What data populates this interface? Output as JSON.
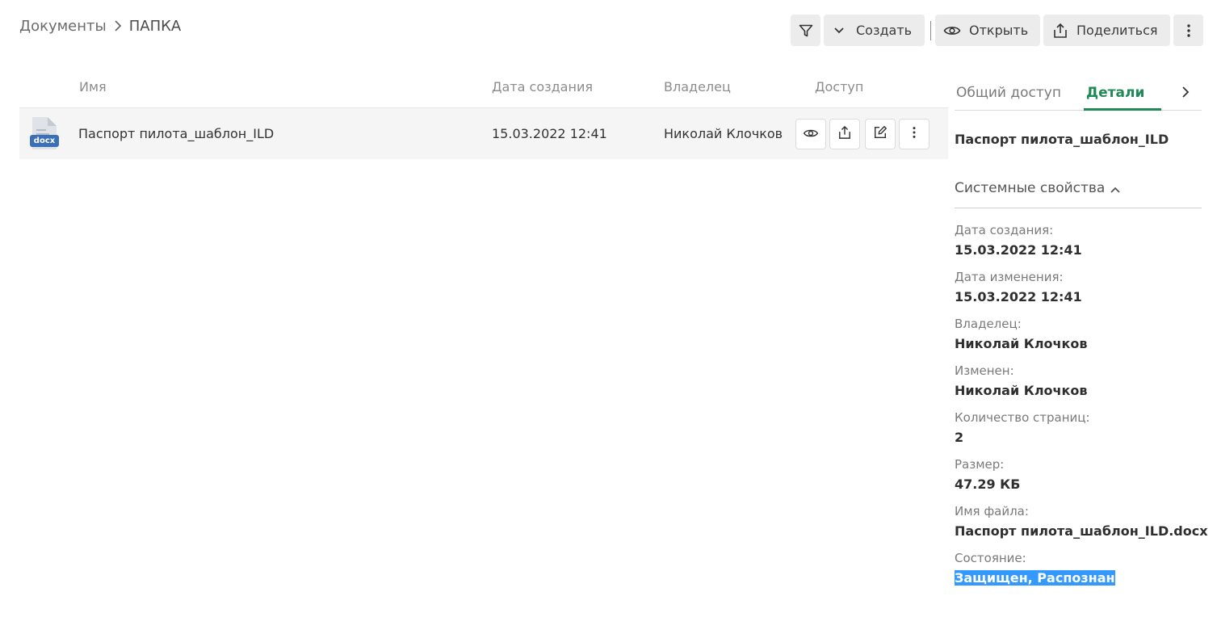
{
  "breadcrumb": {
    "root": "Документы",
    "current": "ПАПКА"
  },
  "toolbar": {
    "filter_icon": "filter-icon",
    "create_label": "Создать",
    "open_label": "Открыть",
    "share_label": "Поделиться"
  },
  "table": {
    "columns": {
      "name": "Имя",
      "created": "Дата создания",
      "owner": "Владелец",
      "access": "Доступ"
    },
    "rows": [
      {
        "icon_label": "docx",
        "name": "Паспорт пилота_шаблон_ILD",
        "created": "15.03.2022 12:41",
        "owner": "Николай Клочков"
      }
    ]
  },
  "panel": {
    "tabs": {
      "sharing": "Общий доступ",
      "details": "Детали"
    },
    "doc_title": "Паспорт пилота_шаблон_ILD",
    "section_title": "Системные свойства",
    "props": [
      {
        "label": "Дата создания:",
        "value": "15.03.2022 12:41"
      },
      {
        "label": "Дата изменения:",
        "value": "15.03.2022 12:41"
      },
      {
        "label": "Владелец:",
        "value": "Николай Клочков"
      },
      {
        "label": "Изменен:",
        "value": "Николай Клочков"
      },
      {
        "label": "Количество страниц:",
        "value": "2"
      },
      {
        "label": "Размер:",
        "value": "47.29 КБ"
      },
      {
        "label": "Имя файла:",
        "value": "Паспорт пилота_шаблон_ILD.docx"
      },
      {
        "label": "Состояние:",
        "value": "Защищен, Распознан"
      }
    ]
  },
  "colors": {
    "accent": "#1f8a55",
    "selection": "#3399ff",
    "row_bg": "#f5f5f5",
    "button_bg": "#ececec",
    "docx_blue": "#3b6fb6"
  }
}
